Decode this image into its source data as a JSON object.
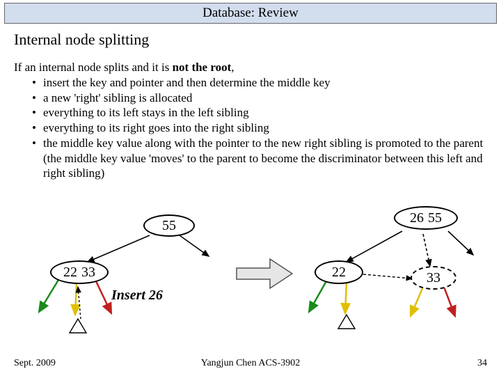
{
  "slide": {
    "title": "Database: Review",
    "section": "Internal node splitting",
    "intro_prefix": "If an internal node splits and it is ",
    "intro_bold": "not the root",
    "intro_suffix": ",",
    "bullets": [
      "insert the key and pointer and then determine the middle key",
      "a new 'right' sibling is allocated",
      "everything to its left stays in the left sibling",
      "everything to its right goes into the right sibling",
      "the middle key value along with the pointer to the new right sibling is promoted to the parent (the middle key value 'moves' to the parent to become the discriminator between this left and right sibling)"
    ],
    "insert_label": "Insert 26",
    "left_tree": {
      "parent_keys": [
        "55"
      ],
      "child_keys": [
        "22",
        "33"
      ]
    },
    "right_tree": {
      "parent_keys": [
        "26",
        "55"
      ],
      "child_left_keys": [
        "22"
      ],
      "child_right_keys": [
        "33"
      ]
    }
  },
  "footer": {
    "date": "Sept. 2009",
    "center": "Yangjun Chen        ACS-3902",
    "page": "34"
  }
}
